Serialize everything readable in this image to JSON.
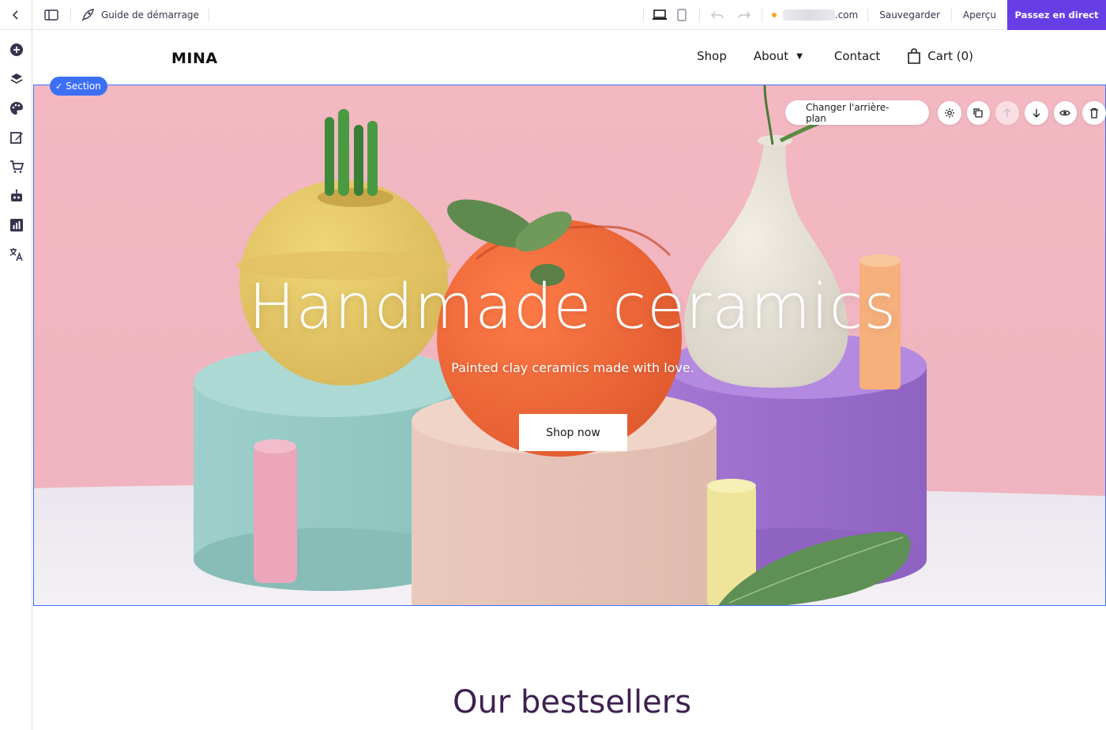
{
  "toolbar": {
    "guide_label": "Guide de démarrage",
    "domain_suffix": ".com",
    "save_label": "Sauvegarder",
    "preview_label": "Aperçu",
    "publish_label": "Passez en direct",
    "accent_color": "#673de6",
    "status_dot_color": "#f5a623"
  },
  "sidebar": {
    "items": [
      {
        "icon": "add-icon"
      },
      {
        "icon": "layers-icon"
      },
      {
        "icon": "palette-icon"
      },
      {
        "icon": "edit-icon"
      },
      {
        "icon": "cart-icon"
      },
      {
        "icon": "robot-icon"
      },
      {
        "icon": "analytics-icon"
      },
      {
        "icon": "translate-icon"
      }
    ]
  },
  "site": {
    "logo": "MINA",
    "nav": {
      "shop": "Shop",
      "about": "About",
      "contact": "Contact",
      "cart": "Cart (0)"
    }
  },
  "hero": {
    "section_badge": "Section",
    "change_background": "Changer l'arrière-plan",
    "title": "Handmade ceramics",
    "subtitle": "Painted clay ceramics made with love.",
    "cta": "Shop now"
  },
  "bestsellers": {
    "heading": "Our bestsellers"
  }
}
